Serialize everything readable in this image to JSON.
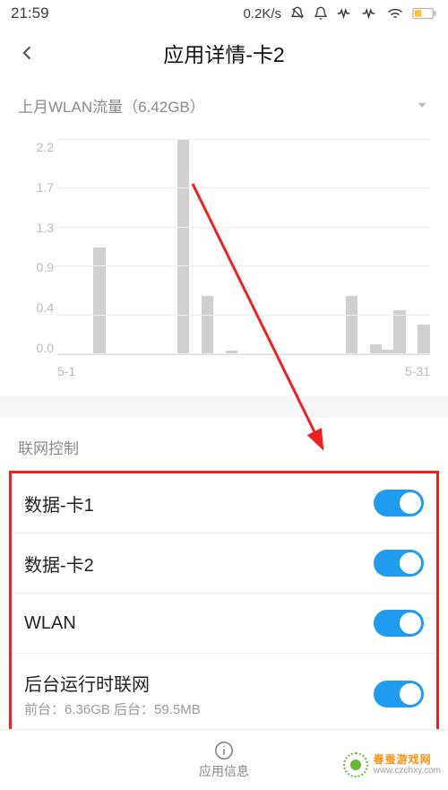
{
  "status": {
    "time": "21:59",
    "net_speed": "0.2K/s"
  },
  "header": {
    "title": "应用详情-卡2"
  },
  "usage_section": {
    "label": "上月WLAN流量（6.42GB）"
  },
  "chart_data": {
    "type": "bar",
    "title": "",
    "xlabel": "",
    "ylabel": "",
    "ylim": [
      0.0,
      2.2
    ],
    "y_ticks": [
      0.0,
      0.4,
      0.9,
      1.3,
      1.7,
      2.2
    ],
    "x_tick_labels": [
      "5-1",
      "5-31"
    ],
    "categories": [
      "5-1",
      "5-2",
      "5-3",
      "5-4",
      "5-5",
      "5-6",
      "5-7",
      "5-8",
      "5-9",
      "5-10",
      "5-11",
      "5-12",
      "5-13",
      "5-14",
      "5-15",
      "5-16",
      "5-17",
      "5-18",
      "5-19",
      "5-20",
      "5-21",
      "5-22",
      "5-23",
      "5-24",
      "5-25",
      "5-26",
      "5-27",
      "5-28",
      "5-29",
      "5-30",
      "5-31"
    ],
    "values": [
      0,
      0,
      0,
      1.1,
      0,
      0,
      0,
      0,
      0,
      0,
      2.2,
      0,
      0.6,
      0,
      0.04,
      0,
      0,
      0,
      0,
      0,
      0,
      0,
      0,
      0,
      0.6,
      0,
      0.1,
      0.05,
      0.45,
      0,
      0.3
    ]
  },
  "network_section": {
    "title": "联网控制",
    "items": [
      {
        "label": "数据-卡1",
        "on": true
      },
      {
        "label": "数据-卡2",
        "on": true
      },
      {
        "label": "WLAN",
        "on": true
      },
      {
        "label": "后台运行时联网",
        "sub": "前台：6.36GB  后台：59.5MB",
        "on": true
      }
    ]
  },
  "bottom": {
    "app_info": "应用信息"
  },
  "watermark": {
    "name": "春蚕游戏网",
    "url": "www.czchxy.com"
  }
}
